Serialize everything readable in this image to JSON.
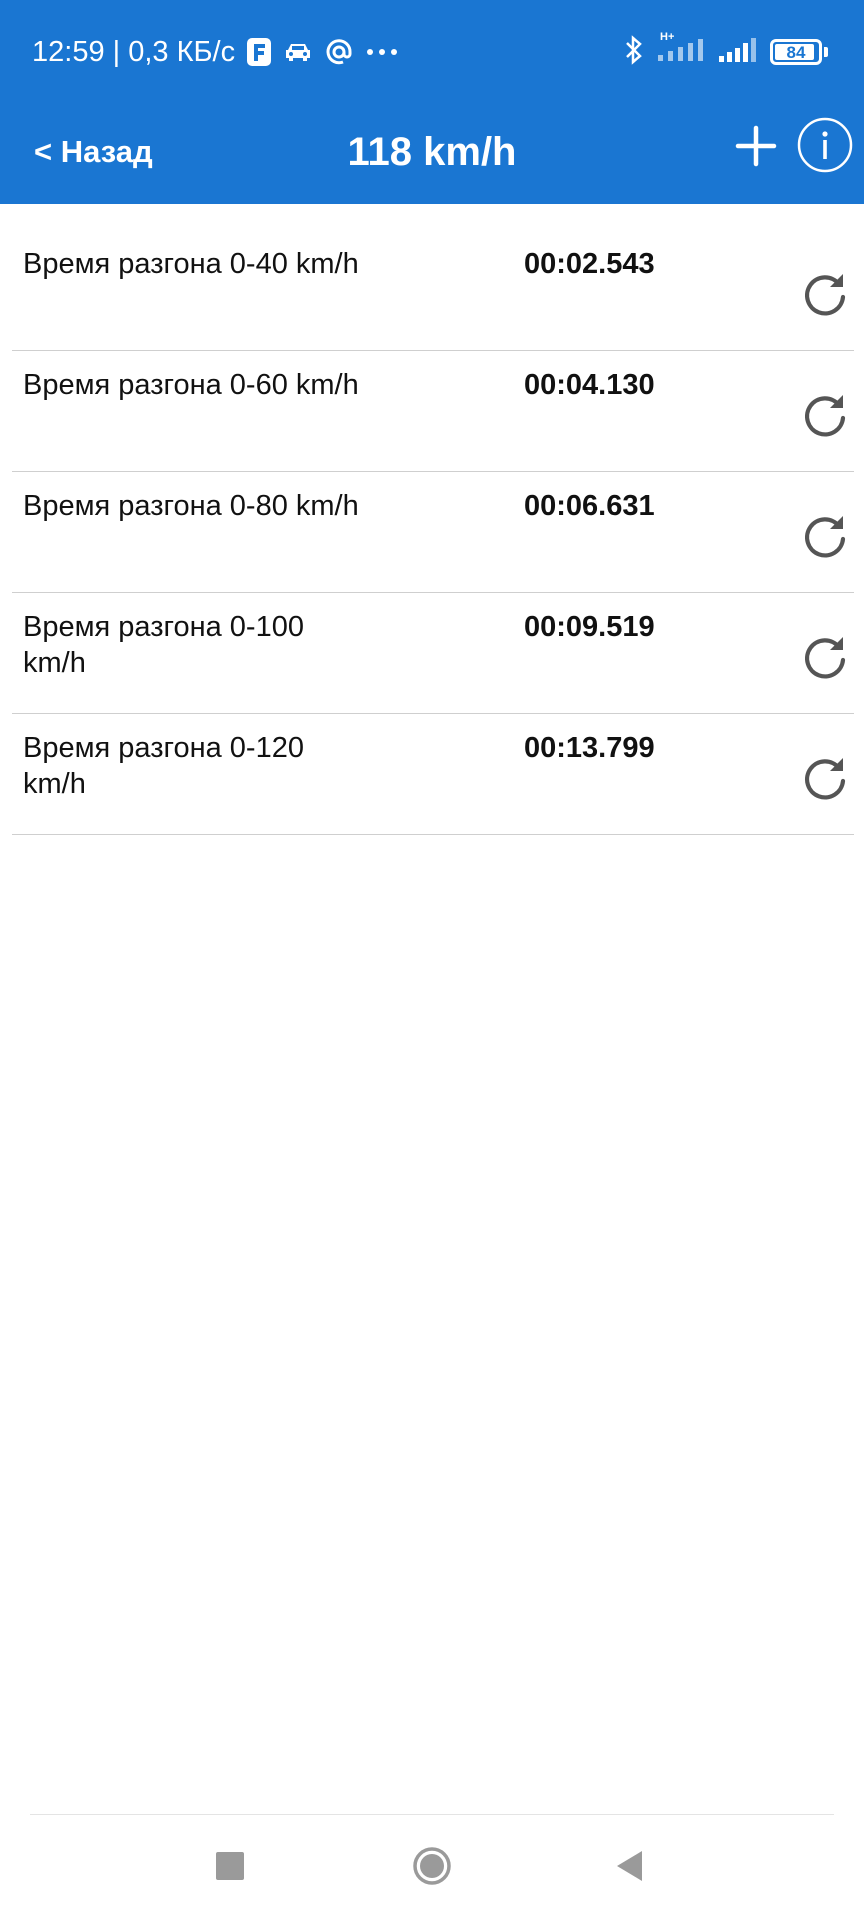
{
  "status_bar": {
    "time_and_speed": "12:59 | 0,3 КБ/с",
    "network_label": "H+",
    "battery_level": "84",
    "icons": [
      "f-app-icon",
      "car-icon",
      "at-icon",
      "more-dots-icon",
      "bluetooth-icon",
      "signal-icon",
      "signal-icon",
      "battery-icon"
    ]
  },
  "header": {
    "back_label": "< Назад",
    "title": "118 km/h",
    "add_icon": "plus-icon",
    "info_icon": "info-icon",
    "color": "#1a76d2"
  },
  "results": [
    {
      "label": "Время разгона  0-40 km/h",
      "time": "00:02.543"
    },
    {
      "label": "Время разгона  0-60 km/h",
      "time": "00:04.130"
    },
    {
      "label": "Время разгона  0-80 km/h",
      "time": "00:06.631"
    },
    {
      "label": "Время разгона  0-100 km/h",
      "time": "00:09.519"
    },
    {
      "label": "Время разгона  0-120 km/h",
      "time": "00:13.799"
    }
  ],
  "row_icon": "refresh-icon",
  "system_nav": [
    "recents-icon",
    "home-icon",
    "back-icon"
  ]
}
